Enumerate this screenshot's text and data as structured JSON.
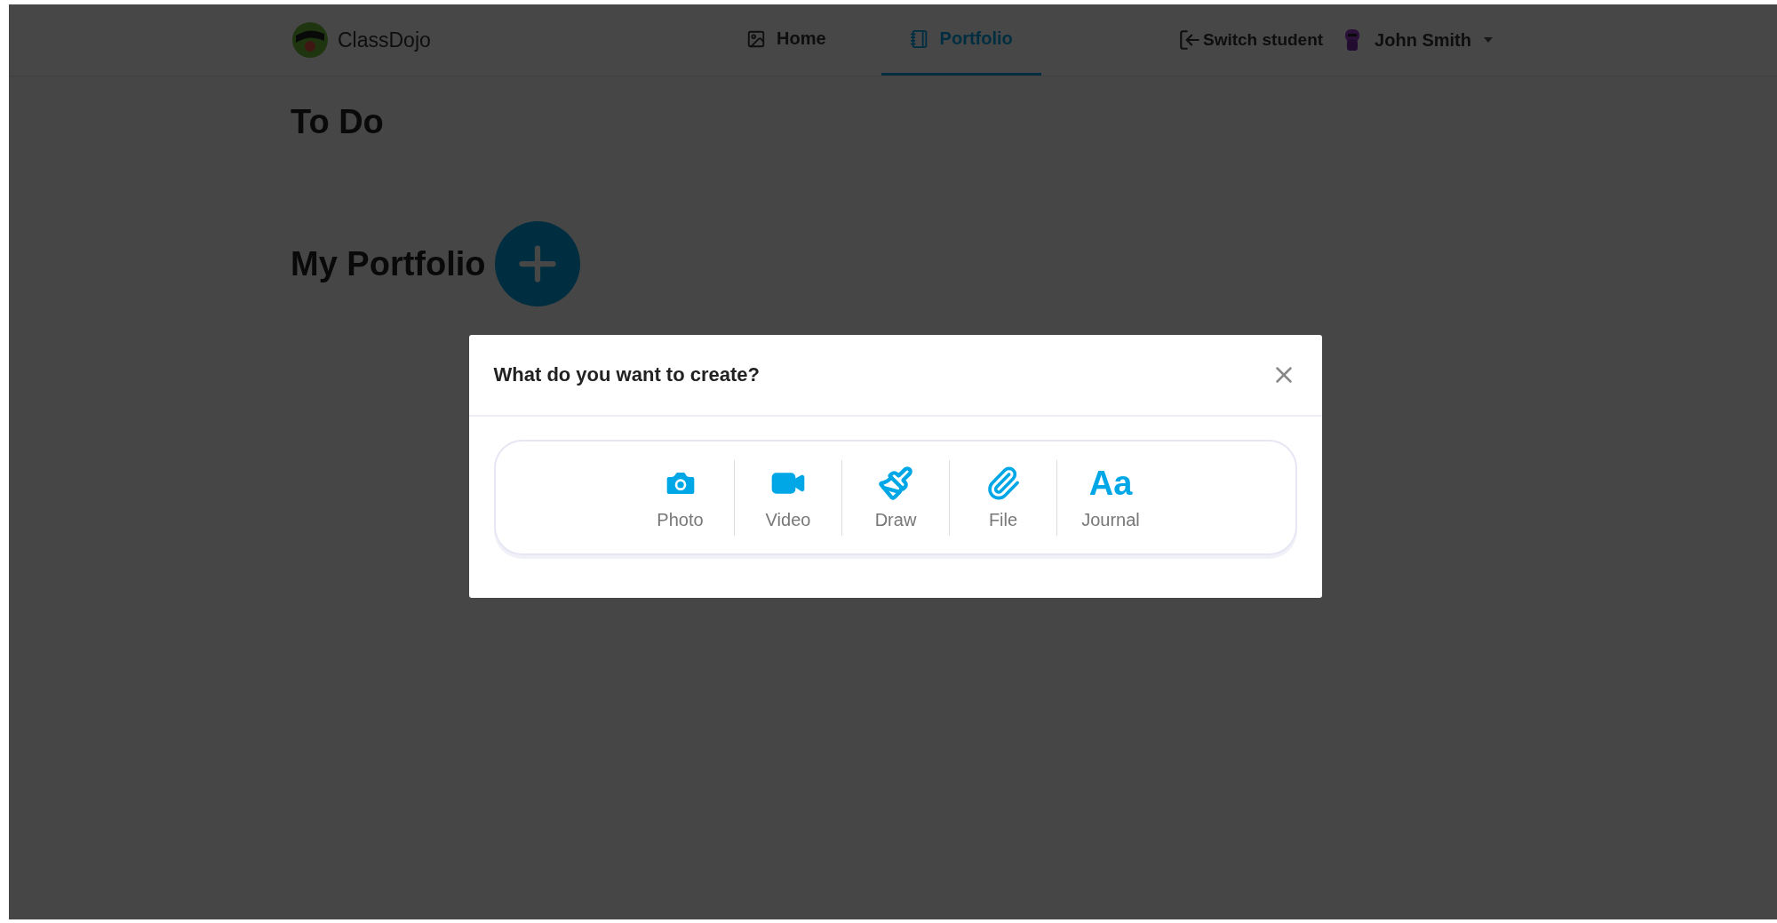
{
  "header": {
    "brand": "ClassDojo",
    "nav": [
      {
        "label": "Home",
        "kind": "home",
        "selected": false
      },
      {
        "label": "Portfolio",
        "kind": "portfolio",
        "selected": true
      }
    ],
    "switch_student": "Switch student",
    "user": "John Smith"
  },
  "sections": [
    {
      "title": "To Do",
      "kind": "plain"
    },
    {
      "title": "My Portfolio",
      "kind": "add"
    }
  ],
  "dialog": {
    "title": "What do you want to create?",
    "options": [
      {
        "label": "Photo",
        "kind": "photo"
      },
      {
        "label": "Video",
        "kind": "video"
      },
      {
        "label": "Draw",
        "kind": "draw"
      },
      {
        "label": "File",
        "kind": "file"
      },
      {
        "label": "Journal",
        "kind": "journal",
        "glyph": "Aa"
      }
    ]
  }
}
